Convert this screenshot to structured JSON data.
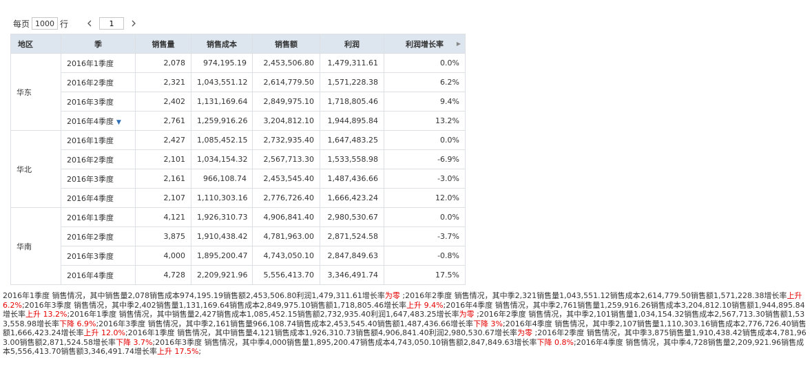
{
  "pager": {
    "per_page_label": "每页",
    "per_page_value": "1000",
    "row_label": "行",
    "page_value": "1",
    "prev_icon": "‹",
    "next_icon": "›"
  },
  "table": {
    "headers": [
      "地区",
      "季",
      "销售量",
      "销售成本",
      "销售额",
      "利润",
      "利润增长率"
    ],
    "groups": [
      {
        "region": "华东",
        "rows": [
          {
            "season": "2016年1季度",
            "qty": "2,078",
            "cost": "974,195.19",
            "sales": "2,453,506.80",
            "profit": "1,479,311.61",
            "growth": "0.0%"
          },
          {
            "season": "2016年2季度",
            "qty": "2,321",
            "cost": "1,043,551.12",
            "sales": "2,614,779.50",
            "profit": "1,571,228.38",
            "growth": "6.2%"
          },
          {
            "season": "2016年3季度",
            "qty": "2,402",
            "cost": "1,131,169.64",
            "sales": "2,849,975.10",
            "profit": "1,718,805.46",
            "growth": "9.4%"
          },
          {
            "season": "2016年4季度",
            "qty": "2,761",
            "cost": "1,259,916.26",
            "sales": "3,204,812.10",
            "profit": "1,944,895.84",
            "growth": "13.2%",
            "dropdown": true
          }
        ]
      },
      {
        "region": "华北",
        "rows": [
          {
            "season": "2016年1季度",
            "qty": "2,427",
            "cost": "1,085,452.15",
            "sales": "2,732,935.40",
            "profit": "1,647,483.25",
            "growth": "0.0%"
          },
          {
            "season": "2016年2季度",
            "qty": "2,101",
            "cost": "1,034,154.32",
            "sales": "2,567,713.30",
            "profit": "1,533,558.98",
            "growth": "-6.9%"
          },
          {
            "season": "2016年3季度",
            "qty": "2,161",
            "cost": "966,108.74",
            "sales": "2,453,545.40",
            "profit": "1,487,436.66",
            "growth": "-3.0%"
          },
          {
            "season": "2016年4季度",
            "qty": "2,107",
            "cost": "1,110,303.16",
            "sales": "2,776,726.40",
            "profit": "1,666,423.24",
            "growth": "12.0%"
          }
        ]
      },
      {
        "region": "华南",
        "rows": [
          {
            "season": "2016年1季度",
            "qty": "4,121",
            "cost": "1,926,310.73",
            "sales": "4,906,841.40",
            "profit": "2,980,530.67",
            "growth": "0.0%"
          },
          {
            "season": "2016年2季度",
            "qty": "3,875",
            "cost": "1,910,438.42",
            "sales": "4,781,963.00",
            "profit": "2,871,524.58",
            "growth": "-3.7%"
          },
          {
            "season": "2016年3季度",
            "qty": "4,000",
            "cost": "1,895,200.47",
            "sales": "4,743,050.10",
            "profit": "2,847,849.63",
            "growth": "-0.8%"
          },
          {
            "season": "2016年4季度",
            "qty": "4,728",
            "cost": "2,209,921.96",
            "sales": "5,556,413.70",
            "profit": "3,346,491.74",
            "growth": "17.5%"
          }
        ]
      }
    ]
  },
  "summary_segments": [
    {
      "text": "2016年1季度 销售情况，其中销售量2,078销售成本974,195.19销售额2,453,506.80利润1,479,311.61增长率"
    },
    {
      "text": "为零",
      "red": true
    },
    {
      "text": " ;2016年2季度 销售情况，其中季2,321销售量1,043,551.12销售成本2,614,779.50销售额1,571,228.38增长率"
    },
    {
      "text": "上升 6.2%",
      "red": true
    },
    {
      "text": ";2016年3季度 销售情况，其中季2,402销售量1,131,169.64销售成本2,849,975.10销售额1,718,805.46增长率"
    },
    {
      "text": "上升 9.4%",
      "red": true
    },
    {
      "text": ";2016年4季度 销售情况，其中季2,761销售量1,259,916.26销售成本3,204,812.10销售额1,944,895.84增长率"
    },
    {
      "text": "上升 13.2%",
      "red": true
    },
    {
      "text": ";2016年1季度 销售情况，其中销售量2,427销售成本1,085,452.15销售额2,732,935.40利润1,647,483.25增长率"
    },
    {
      "text": "为零",
      "red": true
    },
    {
      "text": " ;2016年2季度 销售情况，其中季2,101销售量1,034,154.32销售成本2,567,713.30销售额1,533,558.98增长率"
    },
    {
      "text": "下降 6.9%",
      "red": true
    },
    {
      "text": ";2016年3季度 销售情况，其中季2,161销售量966,108.74销售成本2,453,545.40销售额1,487,436.66增长率"
    },
    {
      "text": "下降 3%",
      "red": true
    },
    {
      "text": ";2016年4季度 销售情况，其中季2,107销售量1,110,303.16销售成本2,776,726.40销售额1,666,423.24增长率"
    },
    {
      "text": "上升 12.0%",
      "red": true
    },
    {
      "text": ";2016年1季度 销售情况，其中销售量4,121销售成本1,926,310.73销售额4,906,841.40利润2,980,530.67增长率"
    },
    {
      "text": "为零",
      "red": true
    },
    {
      "text": " ;2016年2季度 销售情况，其中季3,875销售量1,910,438.42销售成本4,781,963.00销售额2,871,524.58增长率"
    },
    {
      "text": "下降 3.7%",
      "red": true
    },
    {
      "text": ";2016年3季度 销售情况，其中季4,000销售量1,895,200.47销售成本4,743,050.10销售额2,847,849.63增长率"
    },
    {
      "text": "下降 0.8%",
      "red": true
    },
    {
      "text": ";2016年4季度 销售情况，其中季4,728销售量2,209,921.96销售成本5,556,413.70销售额3,346,491.74增长率"
    },
    {
      "text": "上升 17.5%",
      "red": true
    },
    {
      "text": ";"
    }
  ],
  "colors": {
    "header_bg": "#dde6ef",
    "border": "#dcdfe3",
    "highlight_red": "#e60000",
    "dropdown_blue": "#2f6fb5"
  }
}
